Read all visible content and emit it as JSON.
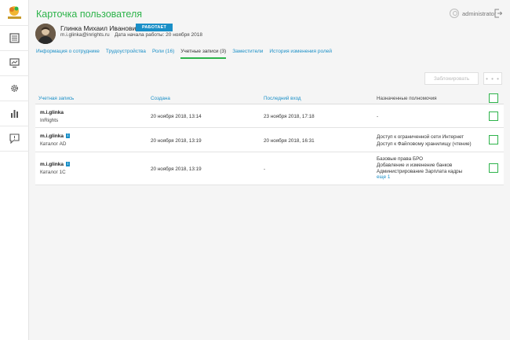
{
  "header": {
    "title": "Карточка пользователя",
    "username": "administrator"
  },
  "profile": {
    "full_name": "Глинка Михаил Иванович",
    "status": "РАБОТАЕТ",
    "email": "m.i.glinka@inrights.ru",
    "start_date": "Дата начала работы: 20 ноября 2018"
  },
  "tabs": [
    {
      "label": "Информация о сотруднике"
    },
    {
      "label": "Трудоустройства"
    },
    {
      "label": "Роли (16)"
    },
    {
      "label": "Учетные записи (3)"
    },
    {
      "label": "Заместители"
    },
    {
      "label": "История изменения ролей"
    }
  ],
  "toolbar": {
    "block_label": "Заблокировать",
    "more_label": "• • •"
  },
  "table": {
    "columns": [
      "Учетная запись",
      "Создана",
      "Последний вход",
      "Назначенные полномочия"
    ],
    "rows": [
      {
        "account": "m.i.glinka",
        "system": "InRights",
        "created": "20 ноября 2018, 13:14",
        "last_login": "23 ноября 2018, 17:18",
        "perms": [
          "-"
        ],
        "more": ""
      },
      {
        "account": "m.i.glinka",
        "system": "Каталог AD",
        "created": "20 ноября 2018, 13:19",
        "last_login": "20 ноября 2018, 16:31",
        "perms": [
          "Доступ к ограниченной сети Интернет",
          "Доступ к Файловому хранилищу (чтение)"
        ],
        "more": ""
      },
      {
        "account": "m.i.glinka",
        "system": "Каталог 1С",
        "created": "20 ноября 2018, 13:19",
        "last_login": "-",
        "perms": [
          "Базовые права БРО",
          "Добавление и изменение банков",
          "Администрирование Зарплата кадры"
        ],
        "more": "еще 1"
      }
    ]
  },
  "colors": {
    "accent_green": "#2db34a",
    "link_blue": "#1a8fc7"
  },
  "icons": [
    "logo-icon",
    "document-icon",
    "monitor-icon",
    "gear-icon",
    "chart-icon",
    "chat-icon",
    "user-icon",
    "logout-icon",
    "info-icon"
  ]
}
